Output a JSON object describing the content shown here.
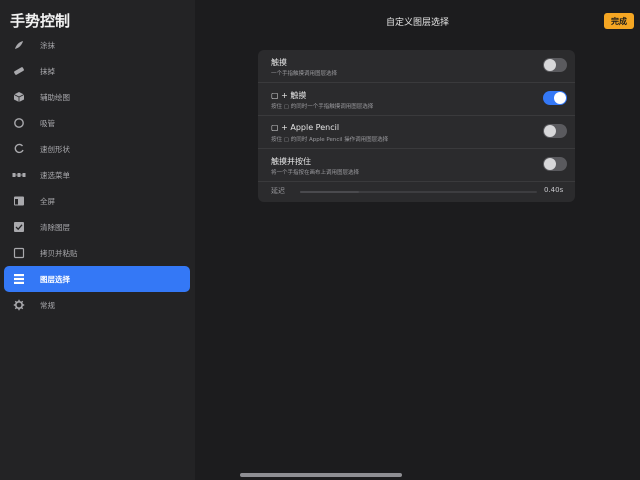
{
  "sidebar": {
    "title": "手势控制",
    "items": [
      {
        "label": "涂抹",
        "icon": "smudge-icon"
      },
      {
        "label": "抹掉",
        "icon": "eraser-icon"
      },
      {
        "label": "辅助绘图",
        "icon": "cube-icon"
      },
      {
        "label": "吸管",
        "icon": "eyedropper-icon"
      },
      {
        "label": "速创形状",
        "icon": "quickshape-icon"
      },
      {
        "label": "速选菜单",
        "icon": "quickmenu-icon"
      },
      {
        "label": "全屏",
        "icon": "fullscreen-icon"
      },
      {
        "label": "清除图层",
        "icon": "clear-layer-icon"
      },
      {
        "label": "拷贝并粘贴",
        "icon": "copy-paste-icon"
      },
      {
        "label": "图层选择",
        "icon": "layer-select-icon"
      },
      {
        "label": "常规",
        "icon": "gear-icon"
      }
    ],
    "active_index": 9
  },
  "header": {
    "title": "自定义图层选择",
    "done_label": "完成"
  },
  "settings": {
    "rows": [
      {
        "title": "触摸",
        "subtitle": "一个手指触摸调用图层选择",
        "on": false
      },
      {
        "title": "▢ + 触摸",
        "subtitle": "按住 ▢ 的同时一个手指触摸调用图层选择",
        "on": true
      },
      {
        "title": "▢ + Apple Pencil",
        "subtitle": "按住 ▢ 的同时 Apple Pencil 操作调用图层选择",
        "on": false
      },
      {
        "title": "触摸并按住",
        "subtitle": "将一个手指按在画布上调用图层选择",
        "on": false
      }
    ],
    "delay": {
      "label": "延迟",
      "value": "0.40s",
      "fraction": 0.25
    }
  },
  "colors": {
    "accent": "#3478f6",
    "done": "#f5a623"
  }
}
